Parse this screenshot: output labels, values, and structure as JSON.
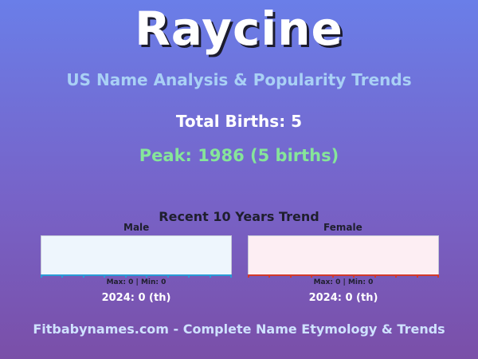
{
  "header": {
    "name": "Raycine",
    "subtitle": "US Name Analysis & Popularity Trends",
    "total_births": "Total Births: 5",
    "peak": "Peak: 1986 (5 births)"
  },
  "trend": {
    "title": "Recent 10 Years Trend",
    "male": {
      "label": "Male",
      "stats": "Max: 0 | Min: 0",
      "rank": "2024: 0 (th)",
      "color": "#2a9bd6"
    },
    "female": {
      "label": "Female",
      "stats": "Max: 0 | Min: 0",
      "rank": "2024: 0 (th)",
      "color": "#d23a2c"
    }
  },
  "footer": {
    "text": "Fitbabynames.com - Complete Name Etymology & Trends"
  },
  "chart_data": [
    {
      "type": "line",
      "series": [
        {
          "name": "Male",
          "values": [
            0,
            0,
            0,
            0,
            0,
            0,
            0,
            0,
            0,
            0
          ]
        }
      ]
    },
    {
      "type": "line",
      "series": [
        {
          "name": "Female",
          "values": [
            0,
            0,
            0,
            0,
            0,
            0,
            0,
            0,
            0,
            0
          ]
        }
      ]
    }
  ]
}
